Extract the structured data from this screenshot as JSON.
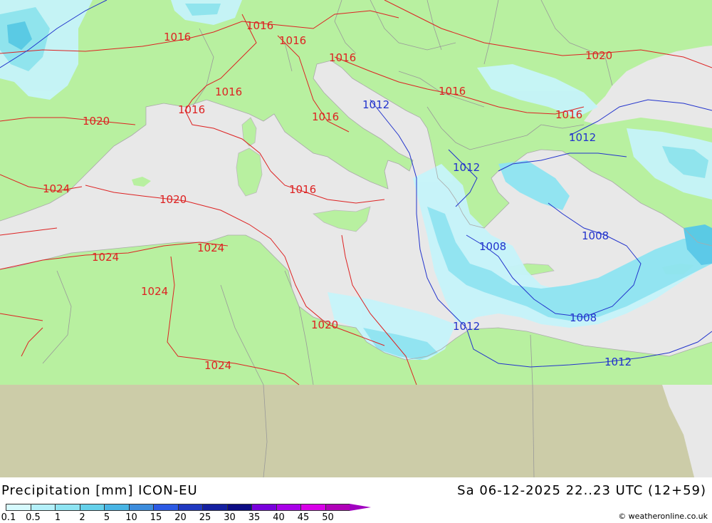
{
  "title": "Precipitation [mm] ICON-EU",
  "datetime": "Sa 06-12-2025 22..23 UTC (12+59)",
  "credit": "© weatheronline.co.uk",
  "colors": {
    "land": "#b8f0a0",
    "sea": "#e8e8e8",
    "outside": "#cccca8",
    "isobar_high": "#dd2222",
    "isobar_low": "#2233cc",
    "precip_light": "#c6f4fa",
    "precip_mid": "#8ee4f2",
    "precip_heavy": "#55c8e8"
  },
  "legend": {
    "labels": [
      "0.1",
      "0.5",
      "1",
      "2",
      "5",
      "10",
      "15",
      "20",
      "25",
      "30",
      "35",
      "40",
      "45",
      "50"
    ],
    "colors": [
      "#d6fafe",
      "#b4f0fa",
      "#8ee4f2",
      "#64d0ea",
      "#48b4e4",
      "#3c8cdc",
      "#2c5ae4",
      "#2038c0",
      "#1420a0",
      "#0c0c84",
      "#7800dc",
      "#a800e8",
      "#d800e8",
      "#b000b8"
    ]
  },
  "isobar_labels": [
    {
      "text": "1016",
      "color": "red"
    },
    {
      "text": "1016",
      "color": "red"
    },
    {
      "text": "1016",
      "color": "red"
    },
    {
      "text": "1016",
      "color": "red"
    },
    {
      "text": "1016",
      "color": "red"
    },
    {
      "text": "1016",
      "color": "red"
    },
    {
      "text": "1016",
      "color": "red"
    },
    {
      "text": "1016",
      "color": "red"
    },
    {
      "text": "1016",
      "color": "red"
    },
    {
      "text": "1016",
      "color": "red"
    },
    {
      "text": "1020",
      "color": "red"
    },
    {
      "text": "1020",
      "color": "red"
    },
    {
      "text": "1020",
      "color": "red"
    },
    {
      "text": "1020",
      "color": "red"
    },
    {
      "text": "1024",
      "color": "red"
    },
    {
      "text": "1024",
      "color": "red"
    },
    {
      "text": "1024",
      "color": "red"
    },
    {
      "text": "1024",
      "color": "red"
    },
    {
      "text": "1024",
      "color": "red"
    },
    {
      "text": "1012",
      "color": "blue"
    },
    {
      "text": "1012",
      "color": "blue"
    },
    {
      "text": "1012",
      "color": "blue"
    },
    {
      "text": "1012",
      "color": "blue"
    },
    {
      "text": "1012",
      "color": "blue"
    },
    {
      "text": "1008",
      "color": "blue"
    },
    {
      "text": "1008",
      "color": "blue"
    },
    {
      "text": "1008",
      "color": "blue"
    }
  ]
}
